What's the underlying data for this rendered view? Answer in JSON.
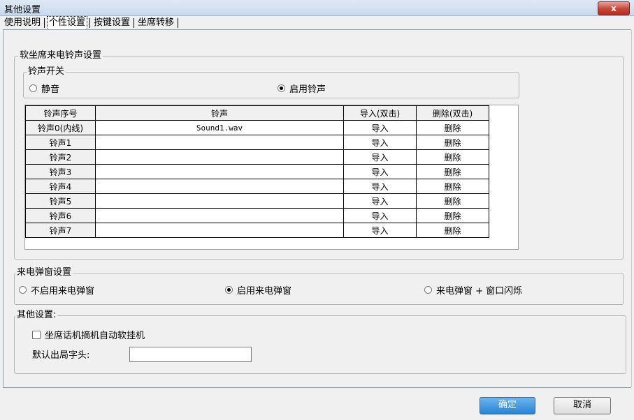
{
  "window": {
    "title": "其他设置",
    "close_label": "x"
  },
  "tabs": [
    {
      "label": "使用说明"
    },
    {
      "label": "个性设置"
    },
    {
      "label": "按键设置"
    },
    {
      "label": "坐席转移"
    }
  ],
  "ring_group": {
    "title": "软坐席来电铃声设置",
    "switch_title": "铃声开关",
    "switch_options": [
      {
        "label": "静音",
        "selected": false
      },
      {
        "label": "启用铃声",
        "selected": true
      }
    ],
    "table": {
      "headers": [
        "铃声序号",
        "铃声",
        "导入(双击)",
        "删除(双击)"
      ],
      "rows": [
        {
          "name": "铃声0(内线)",
          "file": "Sound1.wav",
          "import": "导入",
          "delete": "删除"
        },
        {
          "name": "铃声1",
          "file": "",
          "import": "导入",
          "delete": "删除"
        },
        {
          "name": "铃声2",
          "file": "",
          "import": "导入",
          "delete": "删除"
        },
        {
          "name": "铃声3",
          "file": "",
          "import": "导入",
          "delete": "删除"
        },
        {
          "name": "铃声4",
          "file": "",
          "import": "导入",
          "delete": "删除"
        },
        {
          "name": "铃声5",
          "file": "",
          "import": "导入",
          "delete": "删除"
        },
        {
          "name": "铃声6",
          "file": "",
          "import": "导入",
          "delete": "删除"
        },
        {
          "name": "铃声7",
          "file": "",
          "import": "导入",
          "delete": "删除"
        }
      ]
    }
  },
  "popup_group": {
    "title": "来电弹窗设置",
    "options": [
      {
        "label": "不启用来电弹窗",
        "selected": false
      },
      {
        "label": "启用来电弹窗",
        "selected": true
      },
      {
        "label": "来电弹窗 + 窗口闪烁",
        "selected": false
      }
    ]
  },
  "other_group": {
    "title": "其他设置:",
    "auto_hangup_label": "坐席话机摘机自动软挂机",
    "auto_hangup_checked": false,
    "prefix_label": "默认出局字头:",
    "prefix_value": ""
  },
  "footer": {
    "ok_label": "确定",
    "cancel_label": "取消"
  },
  "colors": {
    "primary_button": "#2a83d5",
    "close_button": "#c8443a"
  }
}
